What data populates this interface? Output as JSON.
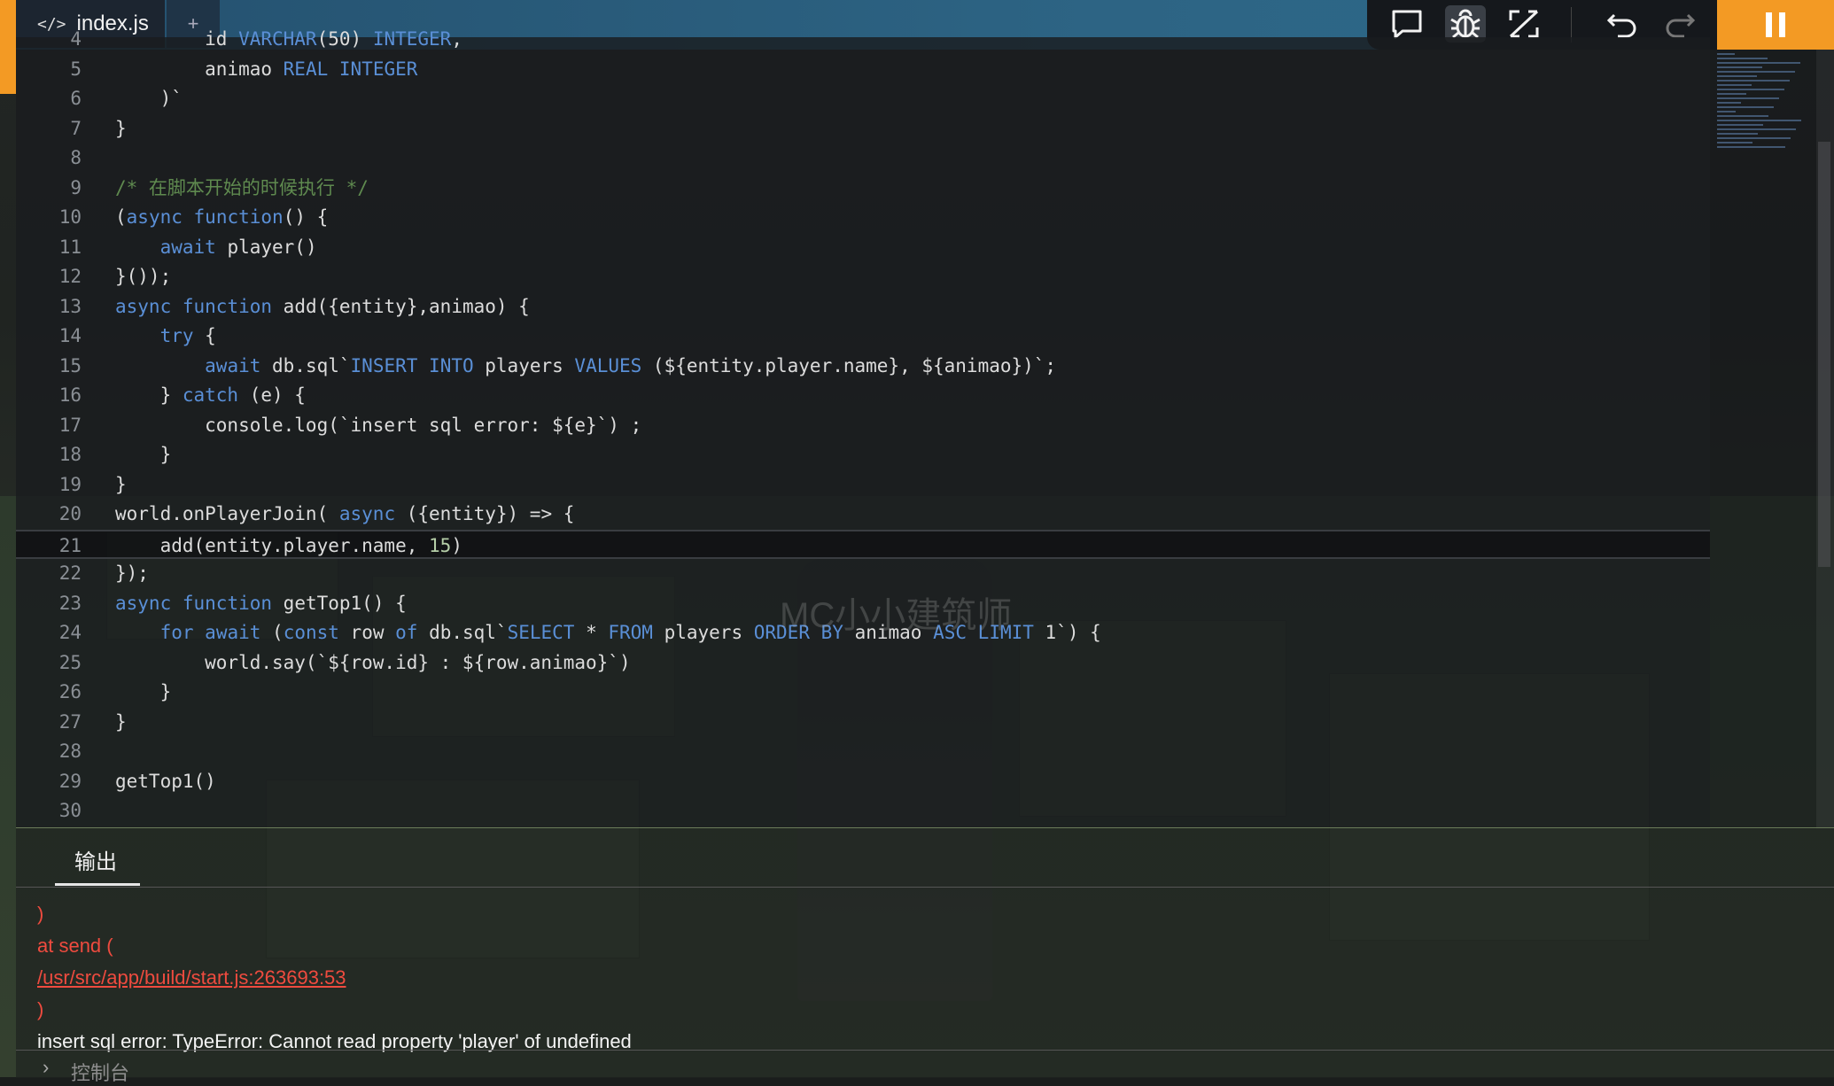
{
  "tab": {
    "code_icon": "</>",
    "label": "index.js",
    "add": "+"
  },
  "toolbar": {
    "icons": [
      "comment-icon",
      "debug-icon",
      "expand-icon",
      "undo-icon",
      "redo-icon",
      "pause-icon"
    ]
  },
  "editor": {
    "watermark": "MC小小建筑师",
    "lines": [
      {
        "n": "4",
        "t": "        id VARCHAR(50) INTEGER,"
      },
      {
        "n": "5",
        "t": "        animao REAL INTEGER"
      },
      {
        "n": "6",
        "t": "    )`"
      },
      {
        "n": "7",
        "t": "}"
      },
      {
        "n": "8",
        "t": ""
      },
      {
        "n": "9",
        "t": "/* 在脚本开始的时候执行 */"
      },
      {
        "n": "10",
        "t": "(async function() {"
      },
      {
        "n": "11",
        "t": "    await player()"
      },
      {
        "n": "12",
        "t": "}());"
      },
      {
        "n": "13",
        "t": "async function add({entity},animao) {"
      },
      {
        "n": "14",
        "t": "    try {"
      },
      {
        "n": "15",
        "t": "        await db.sql`INSERT INTO players VALUES (${entity.player.name}, ${animao})`;"
      },
      {
        "n": "16",
        "t": "    } catch (e) {"
      },
      {
        "n": "17",
        "t": "        console.log(`insert sql error: ${e}`) ;"
      },
      {
        "n": "18",
        "t": "    }"
      },
      {
        "n": "19",
        "t": "}"
      },
      {
        "n": "20",
        "t": "world.onPlayerJoin( async ({entity}) => {"
      },
      {
        "n": "21",
        "t": "    add(entity.player.name, 15)"
      },
      {
        "n": "22",
        "t": "});"
      },
      {
        "n": "23",
        "t": "async function getTop1() {"
      },
      {
        "n": "24",
        "t": "    for await (const row of db.sql`SELECT * FROM players ORDER BY animao ASC LIMIT 1`) {"
      },
      {
        "n": "25",
        "t": "        world.say(`${row.id} : ${row.animao}`)"
      },
      {
        "n": "26",
        "t": "    }"
      },
      {
        "n": "27",
        "t": "}"
      },
      {
        "n": "28",
        "t": ""
      },
      {
        "n": "29",
        "t": "getTop1()"
      },
      {
        "n": "30",
        "t": ""
      }
    ]
  },
  "output": {
    "tab_label": "输出",
    "lines": [
      {
        "kind": "err",
        "text": ")"
      },
      {
        "kind": "err",
        "text": "  at send  ("
      },
      {
        "kind": "link",
        "text": "/usr/src/app/build/start.js:263693:53"
      },
      {
        "kind": "err",
        "text": ")"
      },
      {
        "kind": "info",
        "text": "insert sql error: TypeError: Cannot read property 'player' of undefined"
      }
    ],
    "console_label": "控制台",
    "console_chevron": "›"
  }
}
